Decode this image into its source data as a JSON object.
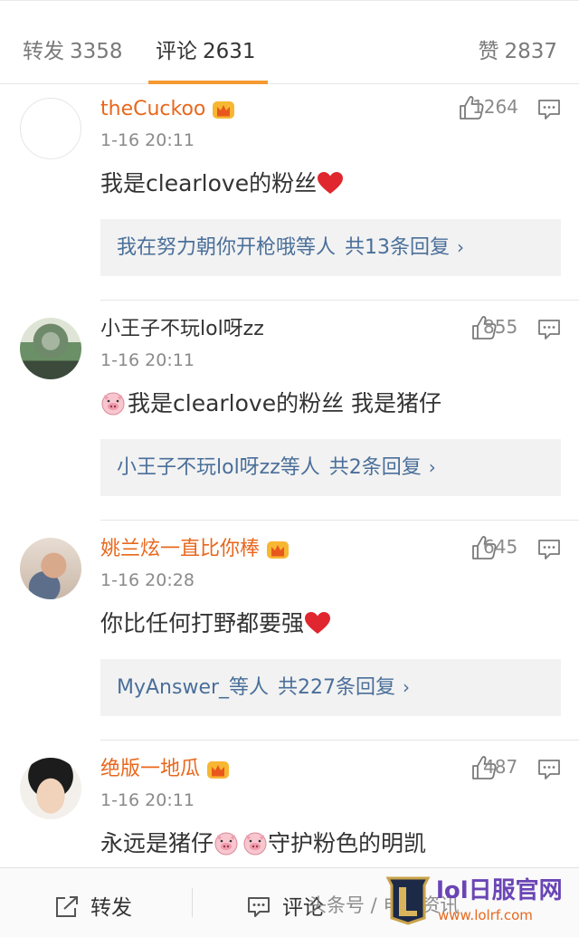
{
  "tabs": {
    "forward_label": "转发",
    "forward_count": "3358",
    "comment_label": "评论",
    "comment_count": "2631",
    "like_label": "赞",
    "like_count": "2837"
  },
  "comments": [
    {
      "username": "theCuckoo",
      "vip": true,
      "time": "1-16 20:11",
      "text": "我是clearlove的粉丝",
      "likes": "1264",
      "reply": {
        "who": "我在努力朝你开枪哦等人",
        "summary": "共13条回复"
      }
    },
    {
      "username": "小王子不玩lol呀zz",
      "vip": false,
      "time": "1-16 20:11",
      "text": "我是clearlove的粉丝 我是猪仔",
      "likes": "855",
      "reply": {
        "who": "小王子不玩lol呀zz等人",
        "summary": "共2条回复"
      }
    },
    {
      "username": "姚兰炫一直比你棒",
      "vip": true,
      "time": "1-16 20:28",
      "text": "你比任何打野都要强",
      "likes": "645",
      "reply": {
        "who": "MyAnswer_等人",
        "summary": "共227条回复"
      }
    },
    {
      "username": "绝版一地瓜",
      "vip": true,
      "time": "1-16 20:11",
      "text_before": "永远是猪仔",
      "text_after": "守护粉色的明凯",
      "likes": "487"
    }
  ],
  "bottom_bar": {
    "forward_label": "转发",
    "comment_label": "评论"
  },
  "watermark": {
    "text": "头条号 / 电竞资讯",
    "brand": "lol日服官网",
    "url": "www.lolrf.com"
  },
  "icons": {
    "like": "thumbs-up-icon",
    "comment": "comment-bubble-icon",
    "vip": "crown-icon",
    "heart": "heart-emoji",
    "pig": "pig-emoji"
  },
  "colors": {
    "accent": "#f49a31",
    "vip_name": "#e8681d",
    "reply_link": "#4a6f9a",
    "heart": "#e0262e"
  }
}
